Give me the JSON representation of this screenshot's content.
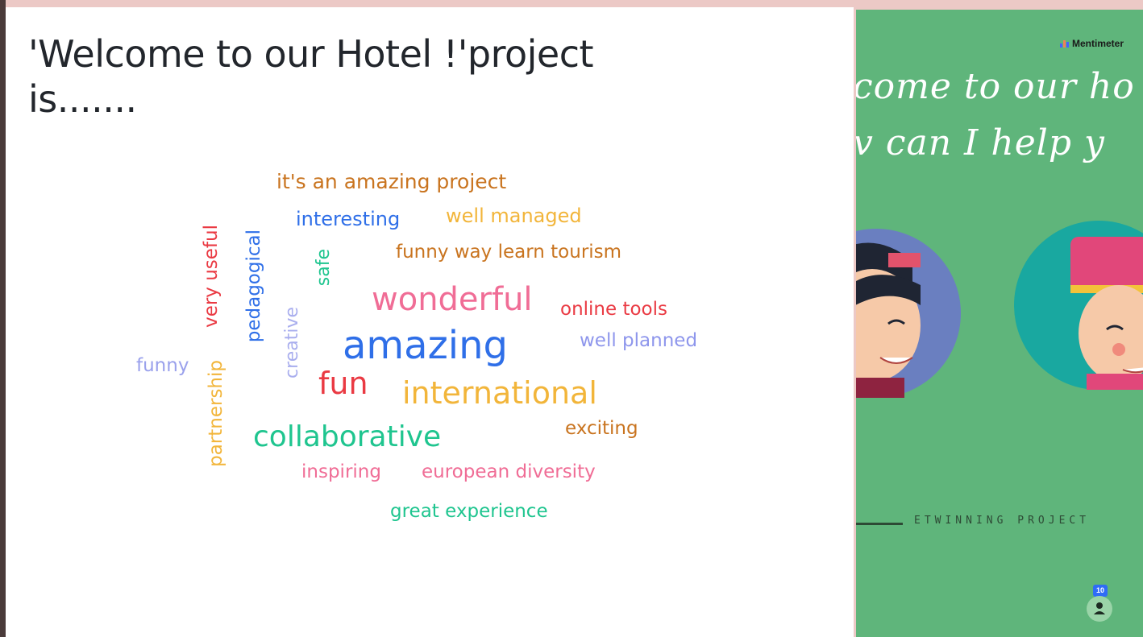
{
  "slide": {
    "title_line1": "'Welcome to our Hotel !'project",
    "title_line2": "is......."
  },
  "word_cloud": {
    "words": [
      {
        "text": "it's an amazing project",
        "color": "#c9741f"
      },
      {
        "text": "interesting",
        "color": "#2f6fe8"
      },
      {
        "text": "well managed",
        "color": "#f2b53a"
      },
      {
        "text": "funny way learn tourism",
        "color": "#c9741f"
      },
      {
        "text": "wonderful",
        "color": "#f06d96"
      },
      {
        "text": "online tools",
        "color": "#ea3a43"
      },
      {
        "text": "well planned",
        "color": "#8e96ec"
      },
      {
        "text": "amazing",
        "color": "#2f6fe8"
      },
      {
        "text": "funny",
        "color": "#9aa1ec"
      },
      {
        "text": "fun",
        "color": "#ea3a43"
      },
      {
        "text": "international",
        "color": "#f2b53a"
      },
      {
        "text": "collaborative",
        "color": "#1fc58f"
      },
      {
        "text": "exciting",
        "color": "#c9741f"
      },
      {
        "text": "inspiring",
        "color": "#f06d96"
      },
      {
        "text": "european diversity",
        "color": "#f06d96"
      },
      {
        "text": "great experience",
        "color": "#1fc58f"
      },
      {
        "text": "very useful",
        "color": "#ea3a43"
      },
      {
        "text": "pedagogical",
        "color": "#2f6fe8"
      },
      {
        "text": "safe",
        "color": "#1fc58f"
      },
      {
        "text": "creative",
        "color": "#a9aeee"
      },
      {
        "text": "partnership",
        "color": "#f2b53a"
      }
    ]
  },
  "sidebar_panel": {
    "brand": "Mentimeter",
    "script_line1": "come to our ho",
    "script_line2": "v can I help y",
    "caption": "ETWINNING PROJECT",
    "participant_count": "10"
  }
}
